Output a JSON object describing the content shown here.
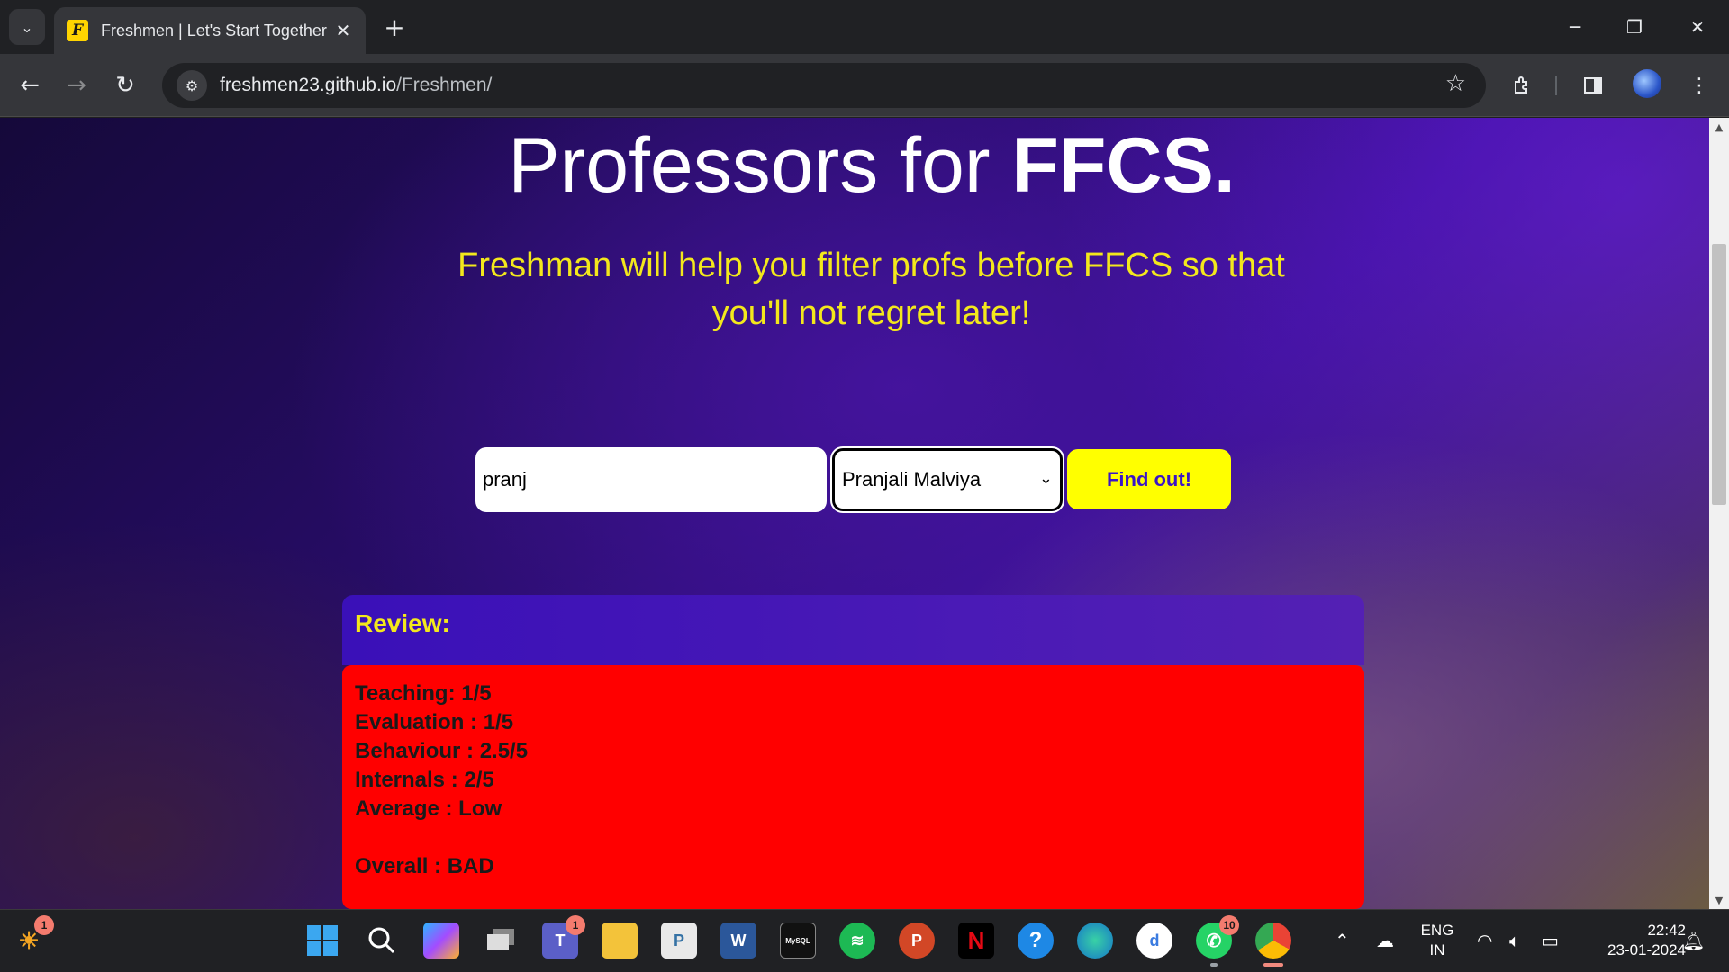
{
  "browser": {
    "tab": {
      "favicon_letter": "F",
      "title": "Freshmen | Let's Start Together",
      "close_symbol": "✕"
    },
    "new_tab_symbol": "+",
    "address": {
      "host": "freshmen23.github.io",
      "path": "/Freshmen/"
    },
    "window_controls": {
      "minimize": "─",
      "restore": "❐",
      "close": "✕"
    }
  },
  "page": {
    "headline_light": "Professors for ",
    "headline_bold": "FFCS.",
    "subtitle": "Freshman will help you filter profs before FFCS so that you'll not regret later!",
    "search": {
      "value": "pranj",
      "placeholder": ""
    },
    "professor_select": {
      "selected": "Pranjali Malviya"
    },
    "find_button": "Find out!",
    "review": {
      "title": "Review:",
      "lines": [
        "Teaching: 1/5",
        "Evaluation : 1/5",
        "Behaviour : 2.5/5",
        "Internals : 2/5",
        "Average : Low"
      ],
      "overall": "Overall : BAD",
      "background_color": "#ff0000"
    },
    "accent_color": "#ffff00",
    "subtitle_color": "#f3e81c"
  },
  "taskbar": {
    "apps": [
      {
        "name": "weather-widget",
        "badge": "1"
      },
      {
        "name": "start",
        "badge": ""
      },
      {
        "name": "search",
        "badge": ""
      },
      {
        "name": "copilot",
        "badge": ""
      },
      {
        "name": "task-view",
        "badge": ""
      },
      {
        "name": "teams",
        "badge": "1"
      },
      {
        "name": "file-explorer",
        "badge": ""
      },
      {
        "name": "python-files",
        "badge": ""
      },
      {
        "name": "word",
        "badge": ""
      },
      {
        "name": "mysql",
        "badge": ""
      },
      {
        "name": "spotify",
        "badge": ""
      },
      {
        "name": "powerpoint",
        "badge": ""
      },
      {
        "name": "netflix",
        "badge": ""
      },
      {
        "name": "help",
        "badge": ""
      },
      {
        "name": "edge",
        "badge": ""
      },
      {
        "name": "d-app",
        "badge": ""
      },
      {
        "name": "whatsapp",
        "badge": "10"
      },
      {
        "name": "chrome",
        "badge": ""
      }
    ],
    "tray": {
      "language_line1": "ENG",
      "language_line2": "IN",
      "time": "22:42",
      "date": "23-01-2024"
    }
  }
}
